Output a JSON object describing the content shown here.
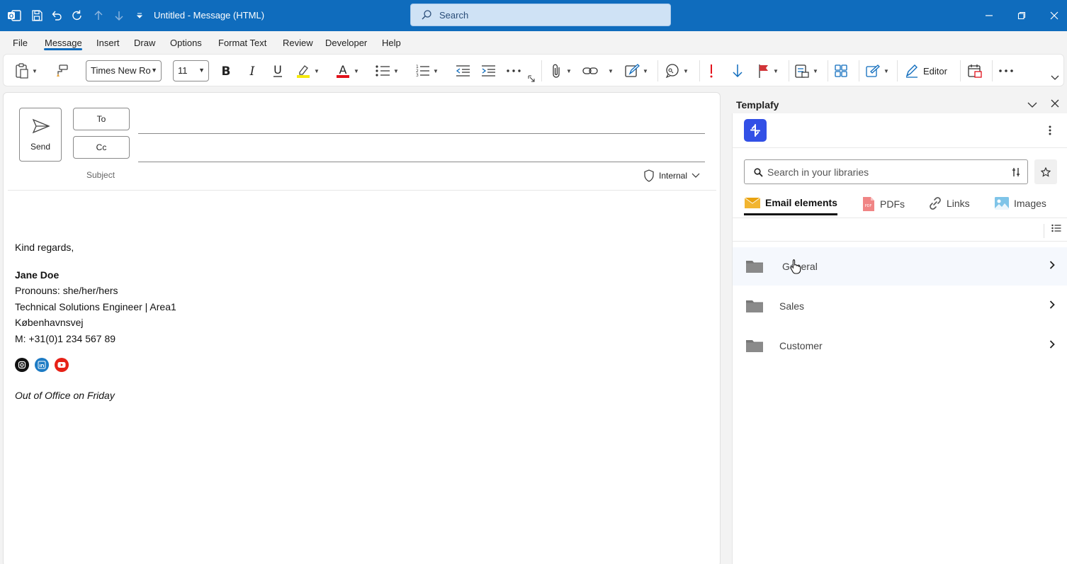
{
  "titlebar": {
    "title": "Untitled  -  Message (HTML)",
    "search_placeholder": "Search"
  },
  "menu": {
    "items": [
      "File",
      "Message",
      "Insert",
      "Draw",
      "Options",
      "Format Text",
      "Review",
      "Developer",
      "Help"
    ],
    "active": "Message"
  },
  "ribbon": {
    "font_name": "Times New Ro",
    "font_size": "11",
    "editor_label": "Editor",
    "colors": {
      "highlight": "#f5e90c",
      "font_color": "#e3121b",
      "importance": "#e3121b",
      "low": "#0f6cbd",
      "flag": "#d13438"
    }
  },
  "compose": {
    "send_label": "Send",
    "to_label": "To",
    "cc_label": "Cc",
    "subject_label": "Subject",
    "sensitivity": "Internal",
    "body": {
      "greeting": "Kind regards,",
      "name": "Jane Doe",
      "pronouns": "Pronouns: she/her/hers",
      "role": "Technical Solutions Engineer | Area1",
      "address": "Københavnsvej",
      "phone": "M: +31(0)1 234 567 89",
      "ooo": "Out of Office on Friday"
    },
    "social_icons": [
      "instagram-icon",
      "linkedin-icon",
      "youtube-icon"
    ]
  },
  "pane": {
    "title": "Templafy",
    "search_placeholder": "Search in your libraries",
    "tabs": [
      {
        "label": "Email elements",
        "icon": "envelope-icon",
        "active": true
      },
      {
        "label": "PDFs",
        "icon": "pdf-icon",
        "active": false
      },
      {
        "label": "Links",
        "icon": "link-icon",
        "active": false
      },
      {
        "label": "Images",
        "icon": "image-icon",
        "active": false
      }
    ],
    "folders": [
      "General",
      "Sales",
      "Customer"
    ],
    "brand_color": "#3250e6"
  }
}
